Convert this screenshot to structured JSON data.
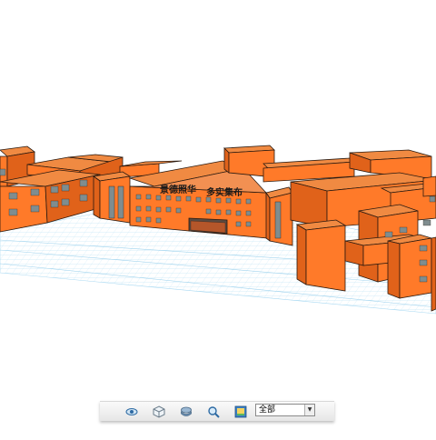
{
  "scene": {
    "banner_left": "景德照华",
    "banner_right": "多实集布",
    "colors": {
      "building": "#ff7a29",
      "building_dark": "#e0621a",
      "window": "#7f8d8f",
      "grid": "#a9d9f2",
      "outline": "#2a1a10"
    }
  },
  "toolbar": {
    "buttons": [
      {
        "name": "eye-icon",
        "tooltip": ""
      },
      {
        "name": "cube-icon",
        "tooltip": ""
      },
      {
        "name": "layers-icon",
        "tooltip": ""
      },
      {
        "name": "magnifier-icon",
        "tooltip": ""
      },
      {
        "name": "picture-icon",
        "tooltip": ""
      }
    ],
    "view_select": {
      "value": "全部"
    }
  }
}
